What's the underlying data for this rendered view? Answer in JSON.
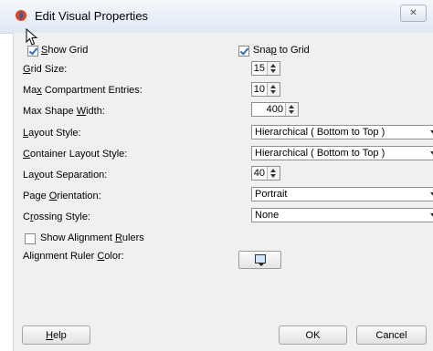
{
  "window": {
    "title": "Edit Visual Properties",
    "close_glyph": "✕"
  },
  "options": {
    "show_grid": {
      "pre": "",
      "ul": "S",
      "post": "how Grid",
      "checked": true
    },
    "snap_to_grid": {
      "pre": "Sna",
      "ul": "p",
      "post": " to Grid",
      "checked": true
    },
    "show_alignment_rulers": {
      "pre": "Show Alignment ",
      "ul": "R",
      "post": "ulers",
      "checked": false
    }
  },
  "fields": {
    "grid_size": {
      "pre": "",
      "ul": "G",
      "post": "rid Size:",
      "value": "15"
    },
    "max_compartment_entries": {
      "pre": "Ma",
      "ul": "x",
      "post": " Compartment Entries:",
      "value": "10"
    },
    "max_shape_width": {
      "pre": "Max Shape ",
      "ul": "W",
      "post": "idth:",
      "value": "400"
    },
    "layout_style": {
      "pre": "",
      "ul": "L",
      "post": "ayout Style:",
      "value": "Hierarchical ( Bottom to Top )"
    },
    "container_layout_style": {
      "pre": "",
      "ul": "C",
      "post": "ontainer Layout Style:",
      "value": "Hierarchical ( Bottom to Top )"
    },
    "layout_separation": {
      "pre": "La",
      "ul": "y",
      "post": "out Separation:",
      "value": "40"
    },
    "page_orientation": {
      "pre": "Page ",
      "ul": "O",
      "post": "rientation:",
      "value": "Portrait"
    },
    "crossing_style": {
      "pre": "C",
      "ul": "r",
      "post": "ossing Style:",
      "value": "None"
    },
    "alignment_ruler_color": {
      "pre": "Alignment Ruler ",
      "ul": "C",
      "post": "olor:"
    }
  },
  "buttons": {
    "help": {
      "pre": "",
      "ul": "H",
      "post": "elp"
    },
    "ok": "OK",
    "cancel": "Cancel"
  },
  "colors": {
    "accent": "#2a6fc7",
    "swatch": "#cfe4ff"
  }
}
